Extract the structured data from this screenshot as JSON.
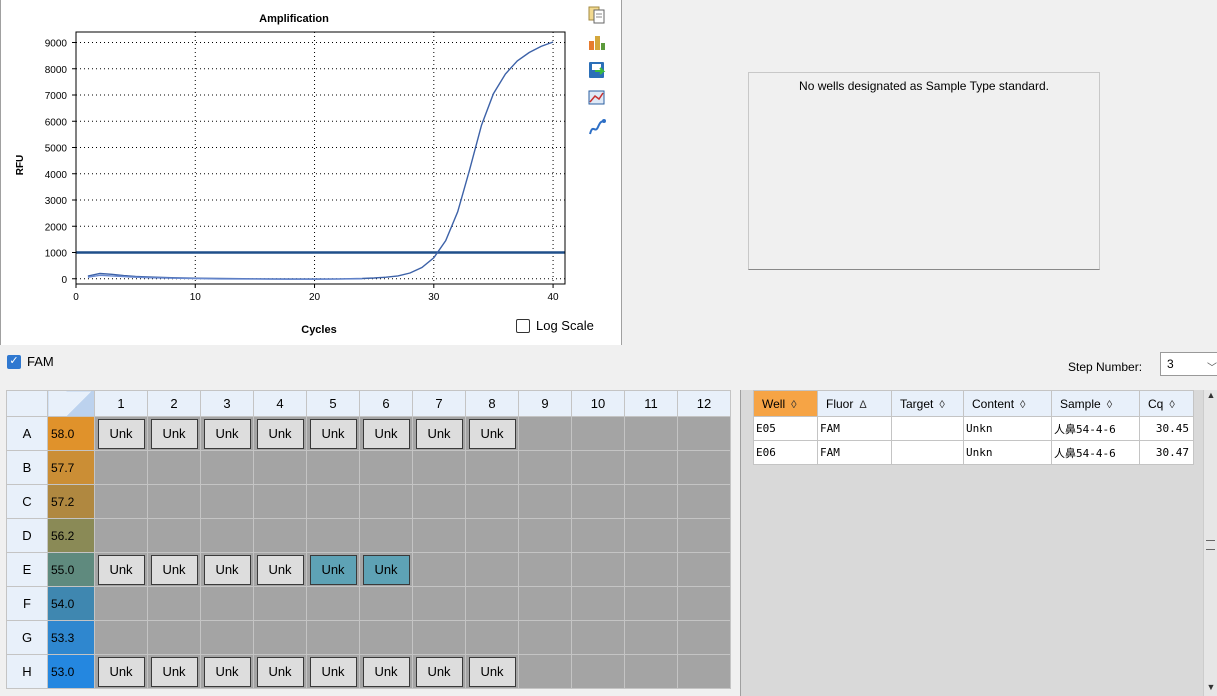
{
  "chart_data": {
    "type": "line",
    "title": "Amplification",
    "xlabel": "Cycles",
    "ylabel": "RFU",
    "xlim": [
      0,
      41
    ],
    "ylim": [
      -200,
      9400
    ],
    "xticks": [
      0,
      10,
      20,
      30,
      40
    ],
    "yticks": [
      0,
      1000,
      2000,
      3000,
      4000,
      5000,
      6000,
      7000,
      8000,
      9000
    ],
    "grid": true,
    "threshold": 1000,
    "series": [
      {
        "color": "#3d62a8",
        "x": [
          1,
          2,
          3,
          4,
          5,
          6,
          8,
          10,
          12,
          15,
          18,
          20,
          22,
          24,
          25,
          26,
          27,
          28,
          29,
          30,
          31,
          32,
          33,
          34,
          35,
          36,
          37,
          38,
          39,
          40
        ],
        "y": [
          100,
          200,
          170,
          120,
          90,
          70,
          40,
          20,
          10,
          0,
          -10,
          -10,
          -5,
          10,
          30,
          60,
          110,
          220,
          430,
          800,
          1450,
          2550,
          4150,
          5850,
          7050,
          7800,
          8300,
          8620,
          8850,
          9020
        ]
      },
      {
        "color": "#6a8ad0",
        "x": [
          1,
          2,
          3,
          4,
          5,
          6,
          8,
          10,
          12,
          15,
          18,
          20,
          22,
          24
        ],
        "y": [
          60,
          130,
          110,
          80,
          60,
          40,
          20,
          5,
          -5,
          -15,
          -20,
          -20,
          -15,
          0
        ]
      }
    ]
  },
  "log_scale": {
    "label": "Log Scale",
    "checked": false
  },
  "standard_panel": {
    "message": "No wells designated as Sample Type standard."
  },
  "fluor": {
    "label": "FAM",
    "checked": true
  },
  "step": {
    "label": "Step Number:",
    "value": "3"
  },
  "plate": {
    "columns": [
      "1",
      "2",
      "3",
      "4",
      "5",
      "6",
      "7",
      "8",
      "9",
      "10",
      "11",
      "12"
    ],
    "rows": [
      {
        "label": "A",
        "temp": "58.0",
        "color": "#e0922b",
        "wells": [
          "Unk",
          "Unk",
          "Unk",
          "Unk",
          "Unk",
          "Unk",
          "Unk",
          "Unk",
          "",
          "",
          "",
          ""
        ]
      },
      {
        "label": "B",
        "temp": "57.7",
        "color": "#cb8e35",
        "wells": [
          "",
          "",
          "",
          "",
          "",
          "",
          "",
          "",
          "",
          "",
          "",
          ""
        ]
      },
      {
        "label": "C",
        "temp": "57.2",
        "color": "#b08840",
        "wells": [
          "",
          "",
          "",
          "",
          "",
          "",
          "",
          "",
          "",
          "",
          "",
          ""
        ]
      },
      {
        "label": "D",
        "temp": "56.2",
        "color": "#8a8a56",
        "wells": [
          "",
          "",
          "",
          "",
          "",
          "",
          "",
          "",
          "",
          "",
          "",
          ""
        ]
      },
      {
        "label": "E",
        "temp": "55.0",
        "color": "#5f8a7e",
        "wells": [
          "Unk",
          "Unk",
          "Unk",
          "Unk",
          "Unk",
          "Unk",
          "",
          "",
          "",
          "",
          "",
          ""
        ]
      },
      {
        "label": "F",
        "temp": "54.0",
        "color": "#3f87b0",
        "wells": [
          "",
          "",
          "",
          "",
          "",
          "",
          "",
          "",
          "",
          "",
          "",
          ""
        ]
      },
      {
        "label": "G",
        "temp": "53.3",
        "color": "#2f87cf",
        "wells": [
          "",
          "",
          "",
          "",
          "",
          "",
          "",
          "",
          "",
          "",
          "",
          ""
        ]
      },
      {
        "label": "H",
        "temp": "53.0",
        "color": "#2487e0",
        "wells": [
          "Unk",
          "Unk",
          "Unk",
          "Unk",
          "Unk",
          "Unk",
          "Unk",
          "Unk",
          "",
          "",
          "",
          ""
        ]
      }
    ],
    "selected": [
      "E5",
      "E6"
    ]
  },
  "results": {
    "headers": [
      {
        "label": "Well",
        "sort": "◊"
      },
      {
        "label": "Fluor",
        "sort": "Δ"
      },
      {
        "label": "Target",
        "sort": "◊"
      },
      {
        "label": "Content",
        "sort": "◊"
      },
      {
        "label": "Sample",
        "sort": "◊"
      },
      {
        "label": "Cq",
        "sort": "◊"
      }
    ],
    "rows": [
      [
        "E05",
        "FAM",
        "",
        "Unkn",
        "人鼻54-4-6",
        "30.45"
      ],
      [
        "E06",
        "FAM",
        "",
        "Unkn",
        "人鼻54-4-6",
        "30.47"
      ]
    ]
  },
  "toolbar_icons": [
    "copy-icon",
    "export-chart-icon",
    "save-image-icon",
    "chart-settings-icon",
    "trace-style-icon"
  ]
}
